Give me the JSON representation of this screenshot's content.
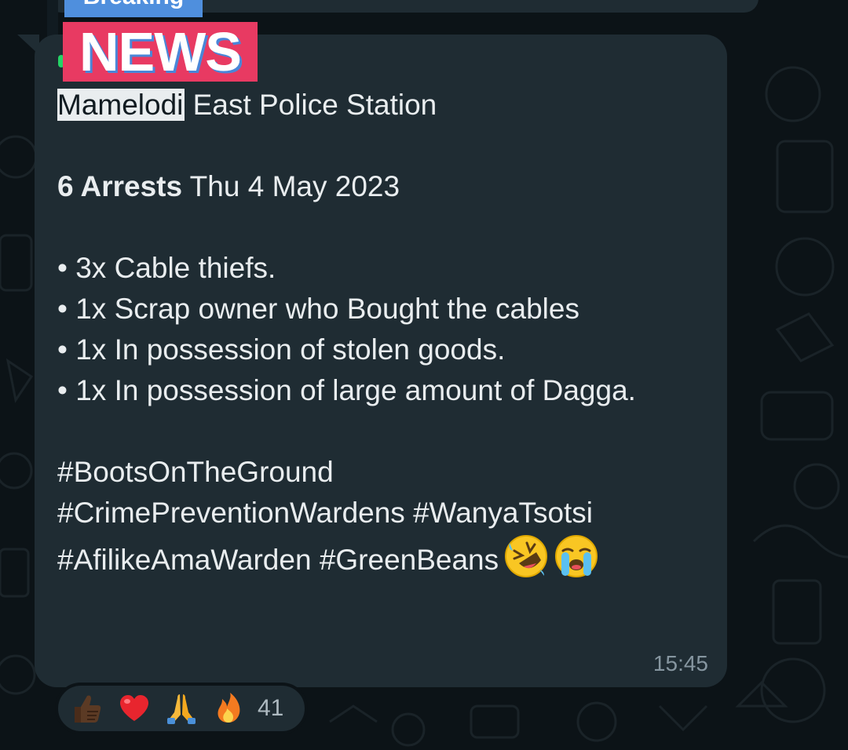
{
  "message": {
    "breaking_badge": "Breaking",
    "news_badge": "NEWS",
    "station_highlight": "Mamelodi",
    "station_rest": " East Police Station",
    "arrests_bold": "6 Arrests",
    "arrests_date": " Thu 4 May 2023",
    "bullets": [
      "• 3x Cable thiefs.",
      "• 1x Scrap owner who Bought the cables",
      "• 1x In possession of stolen goods.",
      "• 1x In possession of large amount of Dagga."
    ],
    "hashtags": [
      "#BootsOnTheGround",
      "#CrimePreventionWardens #WanyaTsotsi",
      "#AfilikeAmaWarden #GreenBeans"
    ],
    "trailing_emojis": [
      "rolling-on-floor-laughing-emoji",
      "loudly-crying-face-emoji"
    ],
    "timestamp": "15:45"
  },
  "reactions": {
    "items": [
      "thumbs-up-dark-skin-icon",
      "red-heart-icon",
      "folded-hands-icon",
      "fire-icon"
    ],
    "count": "41"
  },
  "colors": {
    "background": "#0c1317",
    "bubble": "#1f2c33",
    "news_red": "#e83a62",
    "breaking_blue": "#4f8fdd",
    "text": "#e9edef",
    "meta": "#8696a0"
  }
}
